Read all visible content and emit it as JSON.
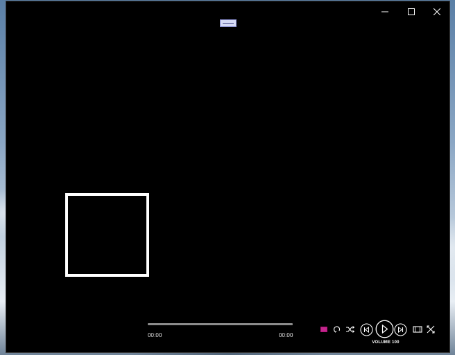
{
  "window": {
    "caption": {
      "minimize_icon": "minimize-icon",
      "maximize_icon": "maximize-icon",
      "close_icon": "close-icon"
    }
  },
  "player": {
    "top_handle_icon": "drag-handle-icon",
    "seek": {
      "current_time": "00:00",
      "total_time": "00:00",
      "progress": 0
    },
    "controls": {
      "playlist_icon": "playlist-icon",
      "repeat_icon": "repeat-icon",
      "shuffle_icon": "shuffle-icon",
      "previous_icon": "skip-previous-icon",
      "play_icon": "play-icon",
      "next_icon": "skip-next-icon",
      "pip_icon": "mini-view-icon",
      "fullscreen_icon": "fullscreen-icon"
    },
    "volume_label": "VOLUME 100"
  },
  "colors": {
    "window_background": "#000000",
    "accent": "#b0107a",
    "control": "#ffffff",
    "seek_track": "#8c8c8c",
    "handle_fill": "#d6dbf5"
  }
}
